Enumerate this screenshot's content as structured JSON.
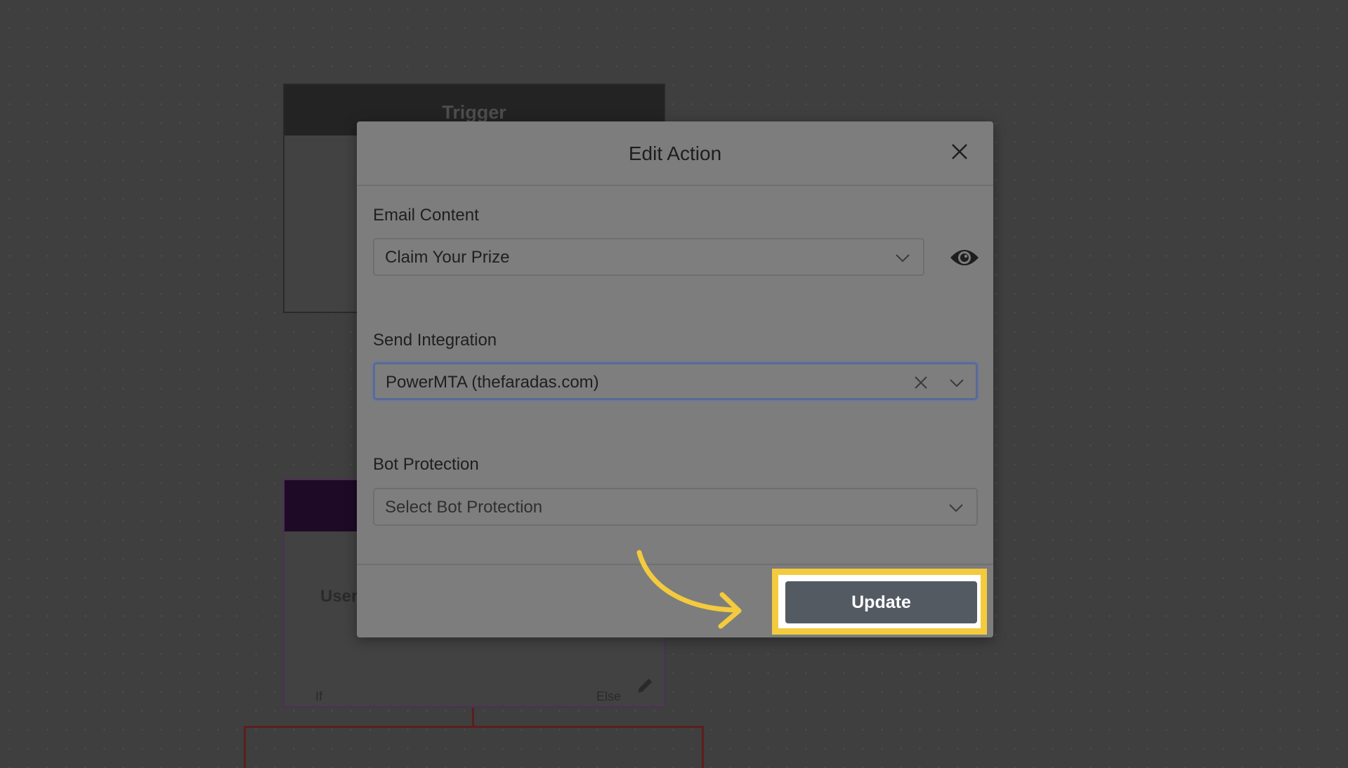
{
  "canvas": {
    "trigger_node": {
      "title": "Trigger"
    },
    "condition_node": {
      "text": "User",
      "if_label": "If",
      "else_label": "Else"
    }
  },
  "modal": {
    "title": "Edit Action",
    "fields": {
      "email_content": {
        "label": "Email Content",
        "value": "Claim Your Prize"
      },
      "send_integration": {
        "label": "Send Integration",
        "value": "PowerMTA (thefaradas.com)"
      },
      "bot_protection": {
        "label": "Bot Protection",
        "placeholder": "Select Bot Protection"
      }
    },
    "update_label": "Update"
  },
  "colors": {
    "highlight": "#f4ca3e",
    "update_button": "#545a62",
    "focus_ring": "#5b6a94"
  },
  "icons": [
    "close-icon",
    "chevron-down-icon",
    "eye-icon",
    "clear-icon",
    "pencil-icon",
    "arrow-annotation"
  ]
}
